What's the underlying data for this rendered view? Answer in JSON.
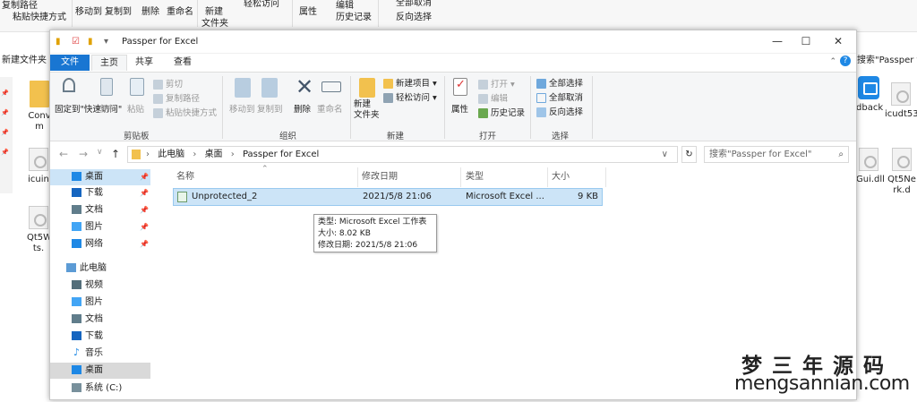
{
  "background": {
    "ribbon": [
      "复制路径",
      "粘贴快捷方式",
      "移动到",
      "复制到",
      "删除",
      "重命名",
      "新建",
      "文件夹",
      "轻松访问",
      "属性",
      "编辑",
      "历史记录",
      "全部取消",
      "反向选择"
    ],
    "address_fragment": "新建文件夹",
    "search_fragment": "搜索\"Passper fo",
    "desktop_files": [
      "Conv m",
      "icuin",
      "Qt5W ts.",
      "dback",
      "icudt53",
      "Gui.dll",
      "Qt5Ne rk.d"
    ]
  },
  "window": {
    "title": "Passper for Excel",
    "tabs": [
      "文件",
      "主页",
      "共享",
      "查看"
    ],
    "ribbon": {
      "clipboard": {
        "pin_label": "固定到\"快速访问\"",
        "copy": "复制",
        "paste": "粘贴",
        "cut": "剪切",
        "copy_path": "复制路径",
        "paste_shortcut": "粘贴快捷方式",
        "group": "剪贴板"
      },
      "organize": {
        "move_to": "移动到",
        "copy_to": "复制到",
        "delete": "删除",
        "rename": "重命名",
        "group": "组织"
      },
      "new": {
        "new_folder": "新建\n文件夹",
        "new_item": "新建项目 ▾",
        "easy_access": "轻松访问 ▾",
        "group": "新建"
      },
      "open": {
        "properties": "属性",
        "open": "打开 ▾",
        "edit": "编辑",
        "history": "历史记录",
        "group": "打开"
      },
      "select": {
        "select_all": "全部选择",
        "select_none": "全部取消",
        "invert": "反向选择",
        "group": "选择"
      }
    },
    "address": {
      "path": [
        "此电脑",
        "桌面",
        "Passper for Excel"
      ],
      "search_placeholder": "搜索\"Passper for Excel\""
    },
    "nav": {
      "quick": [
        {
          "label": "桌面",
          "color": "#1e88e5"
        },
        {
          "label": "下载",
          "color": "#1565c0"
        },
        {
          "label": "文档",
          "color": "#607d8b"
        },
        {
          "label": "图片",
          "color": "#42a5f5"
        },
        {
          "label": "网络",
          "color": "#1e88e5"
        }
      ],
      "pc_label": "此电脑",
      "pc": [
        {
          "label": "视频",
          "color": "#546e7a"
        },
        {
          "label": "图片",
          "color": "#42a5f5"
        },
        {
          "label": "文档",
          "color": "#607d8b"
        },
        {
          "label": "下载",
          "color": "#1565c0"
        },
        {
          "label": "音乐",
          "color": "#1e88e5"
        },
        {
          "label": "桌面",
          "color": "#1e88e5"
        },
        {
          "label": "系统 (C:)",
          "color": "#78909c"
        }
      ],
      "selected": "桌面"
    },
    "columns": {
      "name": "名称",
      "modified": "修改日期",
      "type": "类型",
      "size": "大小"
    },
    "file": {
      "name": "Unprotected_2",
      "modified": "2021/5/8 21:06",
      "type": "Microsoft Excel ...",
      "size": "9 KB"
    },
    "tooltip": {
      "type": "类型: Microsoft Excel 工作表",
      "size": "大小: 8.02 KB",
      "modified": "修改日期: 2021/5/8 21:06"
    }
  },
  "watermark": {
    "cn": "梦三年源码",
    "url": "mengsannian.com"
  }
}
